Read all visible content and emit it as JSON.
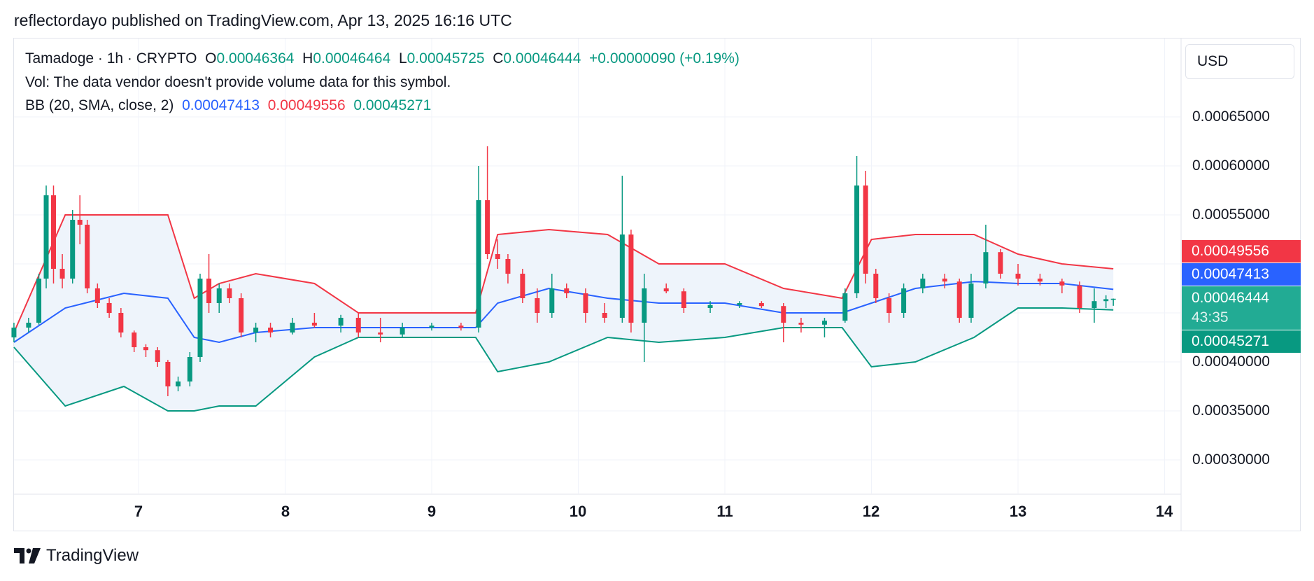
{
  "header": {
    "published": "reflectordayo published on TradingView.com, Apr 13, 2025 16:16 UTC"
  },
  "legend": {
    "symbol": "Tamadoge · 1h · CRYPTO",
    "o_label": "O",
    "o_value": "0.00046364",
    "h_label": "H",
    "h_value": "0.00046464",
    "l_label": "L",
    "l_value": "0.00045725",
    "c_label": "C",
    "c_value": "0.00046444",
    "change": "+0.00000090 (+0.19%)",
    "vol_text": "Vol: The data vendor doesn't provide volume data for this symbol.",
    "bb_label": "BB (20, SMA, close, 2)",
    "bb_basis": "0.00047413",
    "bb_upper": "0.00049556",
    "bb_lower": "0.00045271"
  },
  "price_axis": {
    "currency": "USD",
    "ticks": [
      "0.00065000",
      "0.00060000",
      "0.00055000",
      "0.00040000",
      "0.00035000",
      "0.00030000"
    ],
    "badge_upper": "0.00049556",
    "badge_basis": "0.00047413",
    "badge_last": "0.00046444",
    "badge_countdown": "43:35",
    "badge_lower": "0.00045271"
  },
  "time_axis": {
    "ticks": [
      "7",
      "8",
      "9",
      "10",
      "11",
      "12",
      "13",
      "14"
    ]
  },
  "colors": {
    "up": "#089981",
    "down": "#f23645",
    "basis": "#2962ff",
    "upper": "#f23645",
    "lower": "#089981",
    "fill": "#eef4fb"
  },
  "footer": {
    "brand": "TradingView",
    "logo_icon": "tradingview-logo-icon"
  },
  "chart_data": {
    "type": "candlestick",
    "title": "Tamadoge · 1h · CRYPTO",
    "x_unit": "day of April 2025",
    "ylim": [
      0.00026,
      0.00067
    ],
    "grid": true,
    "bollinger": {
      "x": [
        6.15,
        6.5,
        6.9,
        7.2,
        7.38,
        7.55,
        7.8,
        8.2,
        8.5,
        8.9,
        9.3,
        9.45,
        9.8,
        10.2,
        10.55,
        11.0,
        11.4,
        11.8,
        12.0,
        12.3,
        12.7,
        13.0,
        13.3,
        13.65
      ],
      "upper": [
        0.00043,
        0.00055,
        0.00055,
        0.00055,
        0.000465,
        0.00048,
        0.00049,
        0.00048,
        0.00045,
        0.00045,
        0.00045,
        0.00053,
        0.000535,
        0.00053,
        0.0005,
        0.0005,
        0.000475,
        0.000465,
        0.000525,
        0.00053,
        0.00053,
        0.00051,
        0.0005,
        0.000495
      ],
      "basis": [
        0.00042,
        0.000455,
        0.00047,
        0.000465,
        0.000425,
        0.00042,
        0.00043,
        0.000435,
        0.000435,
        0.000435,
        0.000435,
        0.00046,
        0.000475,
        0.000465,
        0.00046,
        0.00046,
        0.00045,
        0.00045,
        0.00046,
        0.000475,
        0.000482,
        0.00048,
        0.00048,
        0.000474
      ],
      "lower": [
        0.000415,
        0.000355,
        0.000375,
        0.00035,
        0.00035,
        0.000355,
        0.000355,
        0.000405,
        0.000425,
        0.000425,
        0.000425,
        0.00039,
        0.0004,
        0.000425,
        0.00042,
        0.000425,
        0.000435,
        0.000435,
        0.000395,
        0.0004,
        0.000425,
        0.000455,
        0.000455,
        0.000453
      ]
    },
    "candles": [
      {
        "x": 6.15,
        "o": 0.000425,
        "h": 0.00044,
        "l": 0.00042,
        "c": 0.000435
      },
      {
        "x": 6.25,
        "o": 0.000435,
        "h": 0.000445,
        "l": 0.00043,
        "c": 0.00044
      },
      {
        "x": 6.32,
        "o": 0.00044,
        "h": 0.00049,
        "l": 0.000438,
        "c": 0.000485
      },
      {
        "x": 6.37,
        "o": 0.000485,
        "h": 0.00058,
        "l": 0.000475,
        "c": 0.00057
      },
      {
        "x": 6.42,
        "o": 0.00057,
        "h": 0.00058,
        "l": 0.00048,
        "c": 0.000495
      },
      {
        "x": 6.48,
        "o": 0.000495,
        "h": 0.00051,
        "l": 0.000475,
        "c": 0.000485
      },
      {
        "x": 6.55,
        "o": 0.000485,
        "h": 0.000555,
        "l": 0.00048,
        "c": 0.000545
      },
      {
        "x": 6.6,
        "o": 0.000545,
        "h": 0.00057,
        "l": 0.00052,
        "c": 0.00054
      },
      {
        "x": 6.65,
        "o": 0.00054,
        "h": 0.000545,
        "l": 0.00047,
        "c": 0.000475
      },
      {
        "x": 6.72,
        "o": 0.000475,
        "h": 0.00048,
        "l": 0.000455,
        "c": 0.00046
      },
      {
        "x": 6.8,
        "o": 0.00046,
        "h": 0.000465,
        "l": 0.000445,
        "c": 0.00045
      },
      {
        "x": 6.88,
        "o": 0.00045,
        "h": 0.000455,
        "l": 0.000425,
        "c": 0.00043
      },
      {
        "x": 6.97,
        "o": 0.00043,
        "h": 0.000432,
        "l": 0.00041,
        "c": 0.000415
      },
      {
        "x": 7.05,
        "o": 0.000415,
        "h": 0.000418,
        "l": 0.000405,
        "c": 0.000412
      },
      {
        "x": 7.13,
        "o": 0.000412,
        "h": 0.000415,
        "l": 0.000395,
        "c": 0.0004
      },
      {
        "x": 7.2,
        "o": 0.0004,
        "h": 0.000402,
        "l": 0.000365,
        "c": 0.000375
      },
      {
        "x": 7.27,
        "o": 0.000375,
        "h": 0.000385,
        "l": 0.00037,
        "c": 0.00038
      },
      {
        "x": 7.35,
        "o": 0.00038,
        "h": 0.00041,
        "l": 0.000375,
        "c": 0.000405
      },
      {
        "x": 7.42,
        "o": 0.000405,
        "h": 0.00049,
        "l": 0.0004,
        "c": 0.000485
      },
      {
        "x": 7.48,
        "o": 0.000485,
        "h": 0.00051,
        "l": 0.00045,
        "c": 0.00046
      },
      {
        "x": 7.55,
        "o": 0.00046,
        "h": 0.00048,
        "l": 0.00045,
        "c": 0.000475
      },
      {
        "x": 7.62,
        "o": 0.000475,
        "h": 0.00048,
        "l": 0.00046,
        "c": 0.000465
      },
      {
        "x": 7.7,
        "o": 0.000465,
        "h": 0.00047,
        "l": 0.000425,
        "c": 0.00043
      },
      {
        "x": 7.8,
        "o": 0.00043,
        "h": 0.00044,
        "l": 0.00042,
        "c": 0.000435
      },
      {
        "x": 7.9,
        "o": 0.000435,
        "h": 0.00044,
        "l": 0.000425,
        "c": 0.00043
      },
      {
        "x": 8.05,
        "o": 0.00043,
        "h": 0.000445,
        "l": 0.000428,
        "c": 0.00044
      },
      {
        "x": 8.2,
        "o": 0.00044,
        "h": 0.00045,
        "l": 0.000435,
        "c": 0.000437
      },
      {
        "x": 8.38,
        "o": 0.000437,
        "h": 0.000448,
        "l": 0.00043,
        "c": 0.000445
      },
      {
        "x": 8.5,
        "o": 0.000445,
        "h": 0.00045,
        "l": 0.000425,
        "c": 0.00043
      },
      {
        "x": 8.65,
        "o": 0.00043,
        "h": 0.000445,
        "l": 0.00042,
        "c": 0.000428
      },
      {
        "x": 8.8,
        "o": 0.000428,
        "h": 0.00044,
        "l": 0.000425,
        "c": 0.000435
      },
      {
        "x": 9.0,
        "o": 0.000435,
        "h": 0.00044,
        "l": 0.000432,
        "c": 0.000437
      },
      {
        "x": 9.2,
        "o": 0.000437,
        "h": 0.00044,
        "l": 0.000432,
        "c": 0.000435
      },
      {
        "x": 9.32,
        "o": 0.000435,
        "h": 0.0006,
        "l": 0.00043,
        "c": 0.000565
      },
      {
        "x": 9.38,
        "o": 0.000565,
        "h": 0.00062,
        "l": 0.000505,
        "c": 0.00051
      },
      {
        "x": 9.45,
        "o": 0.00051,
        "h": 0.000525,
        "l": 0.000495,
        "c": 0.000505
      },
      {
        "x": 9.52,
        "o": 0.000505,
        "h": 0.00051,
        "l": 0.00048,
        "c": 0.00049
      },
      {
        "x": 9.62,
        "o": 0.00049,
        "h": 0.000495,
        "l": 0.00046,
        "c": 0.000465
      },
      {
        "x": 9.72,
        "o": 0.000465,
        "h": 0.000475,
        "l": 0.00044,
        "c": 0.00045
      },
      {
        "x": 9.82,
        "o": 0.00045,
        "h": 0.00049,
        "l": 0.000445,
        "c": 0.000475
      },
      {
        "x": 9.92,
        "o": 0.000475,
        "h": 0.00048,
        "l": 0.000465,
        "c": 0.00047
      },
      {
        "x": 10.05,
        "o": 0.00047,
        "h": 0.000475,
        "l": 0.00044,
        "c": 0.00045
      },
      {
        "x": 10.18,
        "o": 0.00045,
        "h": 0.00046,
        "l": 0.00044,
        "c": 0.000445
      },
      {
        "x": 10.3,
        "o": 0.000445,
        "h": 0.00059,
        "l": 0.00044,
        "c": 0.00053
      },
      {
        "x": 10.36,
        "o": 0.00053,
        "h": 0.000535,
        "l": 0.00043,
        "c": 0.00044
      },
      {
        "x": 10.45,
        "o": 0.00044,
        "h": 0.00049,
        "l": 0.0004,
        "c": 0.000475
      },
      {
        "x": 10.6,
        "o": 0.000475,
        "h": 0.00048,
        "l": 0.00047,
        "c": 0.000472
      },
      {
        "x": 10.72,
        "o": 0.000472,
        "h": 0.000475,
        "l": 0.00045,
        "c": 0.000455
      },
      {
        "x": 10.9,
        "o": 0.000455,
        "h": 0.000462,
        "l": 0.00045,
        "c": 0.000458
      },
      {
        "x": 11.1,
        "o": 0.000458,
        "h": 0.000462,
        "l": 0.000455,
        "c": 0.00046
      },
      {
        "x": 11.25,
        "o": 0.00046,
        "h": 0.000462,
        "l": 0.000455,
        "c": 0.000457
      },
      {
        "x": 11.4,
        "o": 0.000457,
        "h": 0.00046,
        "l": 0.00042,
        "c": 0.00044
      },
      {
        "x": 11.52,
        "o": 0.00044,
        "h": 0.000445,
        "l": 0.00043,
        "c": 0.000438
      },
      {
        "x": 11.68,
        "o": 0.000438,
        "h": 0.000445,
        "l": 0.000425,
        "c": 0.000442
      },
      {
        "x": 11.82,
        "o": 0.000442,
        "h": 0.000475,
        "l": 0.00044,
        "c": 0.00047
      },
      {
        "x": 11.9,
        "o": 0.00047,
        "h": 0.00061,
        "l": 0.000465,
        "c": 0.00058
      },
      {
        "x": 11.96,
        "o": 0.00058,
        "h": 0.000595,
        "l": 0.00048,
        "c": 0.00049
      },
      {
        "x": 12.03,
        "o": 0.00049,
        "h": 0.000495,
        "l": 0.00046,
        "c": 0.000465
      },
      {
        "x": 12.12,
        "o": 0.000465,
        "h": 0.00047,
        "l": 0.00044,
        "c": 0.00045
      },
      {
        "x": 12.22,
        "o": 0.00045,
        "h": 0.00048,
        "l": 0.000445,
        "c": 0.000475
      },
      {
        "x": 12.35,
        "o": 0.000475,
        "h": 0.00049,
        "l": 0.00047,
        "c": 0.000485
      },
      {
        "x": 12.5,
        "o": 0.000485,
        "h": 0.00049,
        "l": 0.000475,
        "c": 0.000482
      },
      {
        "x": 12.6,
        "o": 0.000482,
        "h": 0.000485,
        "l": 0.00044,
        "c": 0.000445
      },
      {
        "x": 12.68,
        "o": 0.000445,
        "h": 0.00049,
        "l": 0.00044,
        "c": 0.00048
      },
      {
        "x": 12.78,
        "o": 0.00048,
        "h": 0.00054,
        "l": 0.000475,
        "c": 0.000512
      },
      {
        "x": 12.88,
        "o": 0.000512,
        "h": 0.000515,
        "l": 0.000485,
        "c": 0.00049
      },
      {
        "x": 13.0,
        "o": 0.00049,
        "h": 0.0005,
        "l": 0.000478,
        "c": 0.000485
      },
      {
        "x": 13.15,
        "o": 0.000485,
        "h": 0.00049,
        "l": 0.000478,
        "c": 0.000482
      },
      {
        "x": 13.3,
        "o": 0.000482,
        "h": 0.000485,
        "l": 0.00047,
        "c": 0.000478
      },
      {
        "x": 13.42,
        "o": 0.000478,
        "h": 0.000482,
        "l": 0.00045,
        "c": 0.000455
      },
      {
        "x": 13.52,
        "o": 0.000455,
        "h": 0.000475,
        "l": 0.00044,
        "c": 0.000462
      },
      {
        "x": 13.6,
        "o": 0.000462,
        "h": 0.000468,
        "l": 0.000455,
        "c": 0.000464
      },
      {
        "x": 13.65,
        "o": 0.00046364,
        "h": 0.00046464,
        "l": 0.00045725,
        "c": 0.00046444
      }
    ]
  }
}
